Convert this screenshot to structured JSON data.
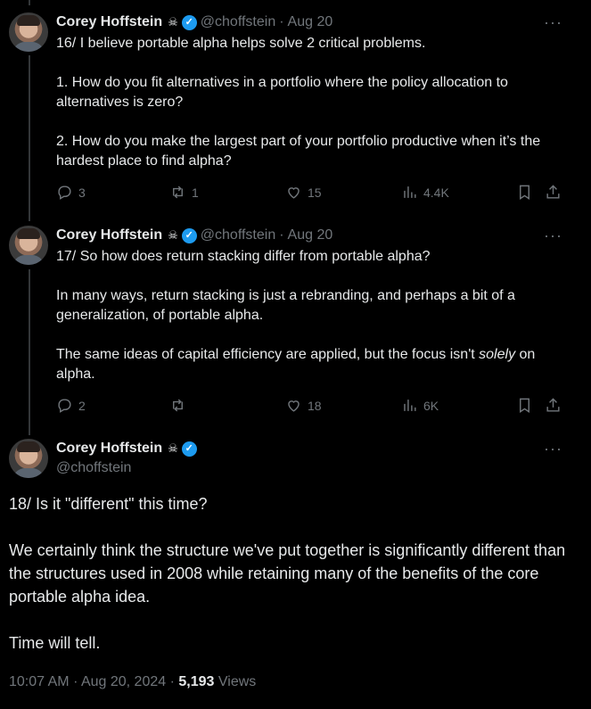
{
  "author": {
    "name": "Corey Hoffstein",
    "badge": "☠",
    "handle": "@choffstein"
  },
  "tweets": [
    {
      "date": "Aug 20",
      "paragraphs": [
        "16/ I believe portable alpha helps solve 2 critical problems.",
        "1. How do you fit alternatives in a portfolio where the policy allocation to alternatives is zero?",
        "2. How do you make the largest part of your portfolio productive when it’s the hardest place to find alpha?"
      ],
      "replies": "3",
      "retweets": "1",
      "likes": "15",
      "views": "4.4K"
    },
    {
      "date": "Aug 20",
      "paragraphs": [
        "17/ So how does return stacking differ from portable alpha?",
        "In many ways, return stacking is just a rebranding, and perhaps a bit of a generalization, of portable alpha.",
        "The same ideas of capital efficiency are applied, but the focus isn't"
      ],
      "emph": "solely",
      "tail": " on alpha.",
      "replies": "2",
      "retweets": "",
      "likes": "18",
      "views": "6K"
    }
  ],
  "main": {
    "paragraphs": [
      "18/ Is it \"different\" this time?",
      "We certainly think the structure we've put together is significantly different than the structures used in 2008 while retaining many of the benefits of the core portable alpha idea.",
      "Time will tell."
    ],
    "time": "10:07 AM",
    "date": "Aug 20, 2024",
    "views_count": "5,193",
    "views_label": "Views"
  },
  "more_label": "···",
  "dot": "·",
  "verified_mark": "✓"
}
